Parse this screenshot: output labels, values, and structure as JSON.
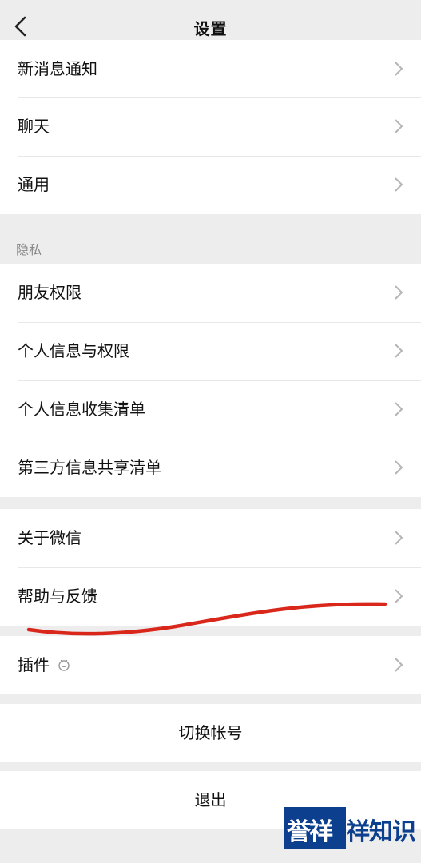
{
  "header": {
    "title": "设置"
  },
  "groups": {
    "general": [
      {
        "label": "新消息通知"
      },
      {
        "label": "聊天"
      },
      {
        "label": "通用"
      }
    ],
    "privacy_section_label": "隐私",
    "privacy": [
      {
        "label": "朋友权限"
      },
      {
        "label": "个人信息与权限"
      },
      {
        "label": "个人信息收集清单"
      },
      {
        "label": "第三方信息共享清单"
      }
    ],
    "about": [
      {
        "label": "关于微信"
      },
      {
        "label": "帮助与反馈"
      }
    ],
    "plugins": [
      {
        "label": "插件"
      }
    ]
  },
  "actions": {
    "switch_account": "切换帐号",
    "logout": "退出"
  },
  "annotation": {
    "stroke_color": "#d9271b"
  },
  "watermark": {
    "part_a": "誉祥",
    "part_b": "祥知识"
  },
  "colors": {
    "background": "#ededed",
    "card": "#ffffff",
    "watermark_blue": "#0d3f8f"
  },
  "icons": {
    "back": "chevron-left-icon",
    "row_arrow": "chevron-right-icon",
    "plugin": "plugin-badge-icon"
  }
}
